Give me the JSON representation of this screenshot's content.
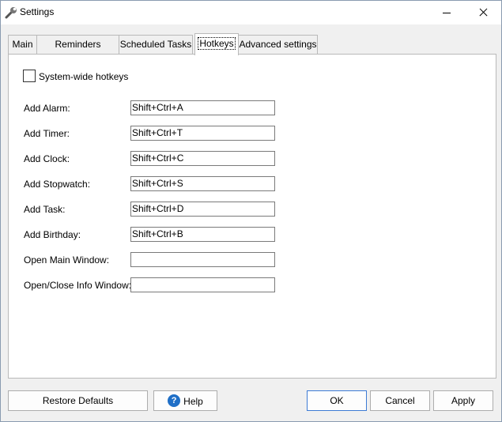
{
  "window": {
    "title": "Settings",
    "icon": "wrench-icon"
  },
  "tabs": [
    {
      "label": "Main"
    },
    {
      "label": "Reminders Window"
    },
    {
      "label": "Scheduled Tasks"
    },
    {
      "label": "Hotkeys",
      "active": true
    },
    {
      "label": "Advanced settings"
    }
  ],
  "hotkeys": {
    "system_wide_label": "System-wide hotkeys",
    "system_wide_checked": false,
    "fields": [
      {
        "label": "Add Alarm:",
        "value": "Shift+Ctrl+A"
      },
      {
        "label": "Add Timer:",
        "value": "Shift+Ctrl+T"
      },
      {
        "label": "Add Clock:",
        "value": "Shift+Ctrl+C"
      },
      {
        "label": "Add Stopwatch:",
        "value": "Shift+Ctrl+S"
      },
      {
        "label": "Add Task:",
        "value": "Shift+Ctrl+D"
      },
      {
        "label": "Add Birthday:",
        "value": "Shift+Ctrl+B"
      },
      {
        "label": "Open Main Window:",
        "value": ""
      },
      {
        "label": "Open/Close Info Window:",
        "value": ""
      }
    ]
  },
  "buttons": {
    "restore_defaults": "Restore Defaults",
    "help": "Help",
    "help_icon_glyph": "?",
    "ok": "OK",
    "cancel": "Cancel",
    "apply": "Apply"
  },
  "colors": {
    "accent": "#3d7bd5",
    "help_icon": "#1f6fc7"
  }
}
